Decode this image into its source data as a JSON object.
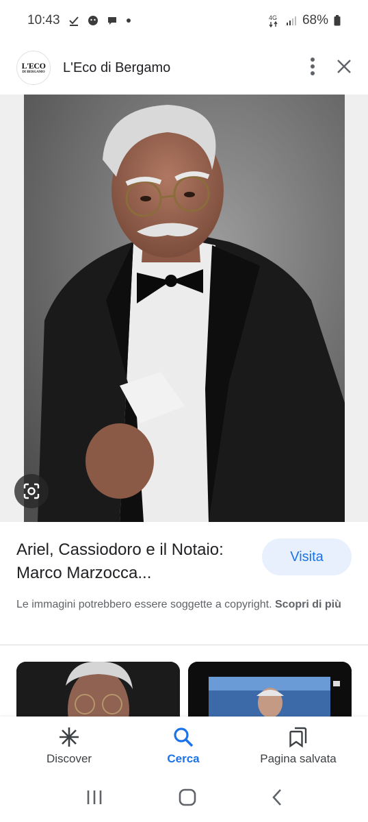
{
  "status_bar": {
    "time": "10:43",
    "network": "4G",
    "battery": "68%"
  },
  "header": {
    "logo_text_top": "L'ECO",
    "logo_text_bottom": "DI BERGAMO",
    "site_name": "L'Eco di Bergamo",
    "icons": [
      "more-vert-icon",
      "close-icon"
    ]
  },
  "result": {
    "title": "Ariel, Cassiodoro e il Notaio: Marco Marzocca...",
    "visit_label": "Visita",
    "copyright_text": "Le immagini potrebbero essere soggette a copyright.",
    "copyright_link": "Scopri di più"
  },
  "bottom_nav": {
    "items": [
      {
        "label": "Discover",
        "icon": "asterisk-icon",
        "active": false
      },
      {
        "label": "Cerca",
        "icon": "search-icon",
        "active": true
      },
      {
        "label": "Pagina salvata",
        "icon": "saved-pages-icon",
        "active": false
      }
    ]
  },
  "colors": {
    "accent": "#1a73e8",
    "visit_bg": "#e8f0fe",
    "secondary_text": "#5f6368"
  }
}
